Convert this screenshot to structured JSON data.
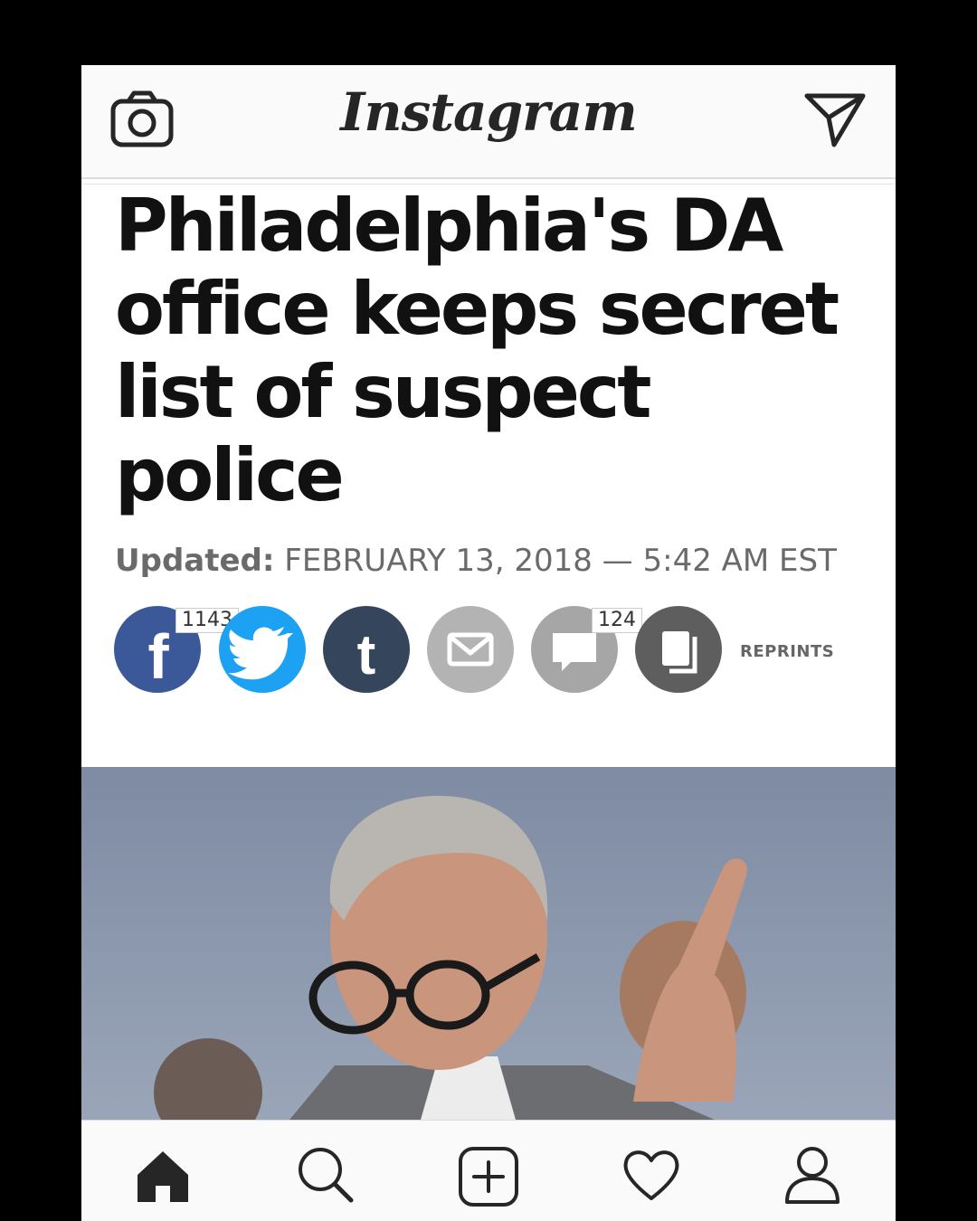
{
  "app": {
    "name": "Instagram"
  },
  "header": {
    "camera_icon": "camera-icon",
    "direct_icon": "paper-plane-icon"
  },
  "article": {
    "headline": "Philadelphia's DA office keeps secret list of suspect police",
    "updated_label": "Updated:",
    "updated_value": "FEBRUARY 13, 2018 — 5:42 AM EST"
  },
  "share_bar": {
    "facebook_count": "1143",
    "comments_count": "124",
    "reprints_label": "REPRINTS",
    "icons": [
      "facebook-icon",
      "twitter-icon",
      "tumblr-icon",
      "email-icon",
      "comment-icon",
      "copy-icon"
    ],
    "colors": {
      "facebook": "#3b5998",
      "twitter": "#1da1f2",
      "tumblr": "#35465c",
      "email": "#b3b3b3",
      "comments": "#a6a6a6",
      "reprints": "#5e5e5e"
    }
  },
  "bottom_nav": {
    "icons": [
      "home-icon",
      "search-icon",
      "add-post-icon",
      "heart-icon",
      "profile-icon"
    ]
  }
}
